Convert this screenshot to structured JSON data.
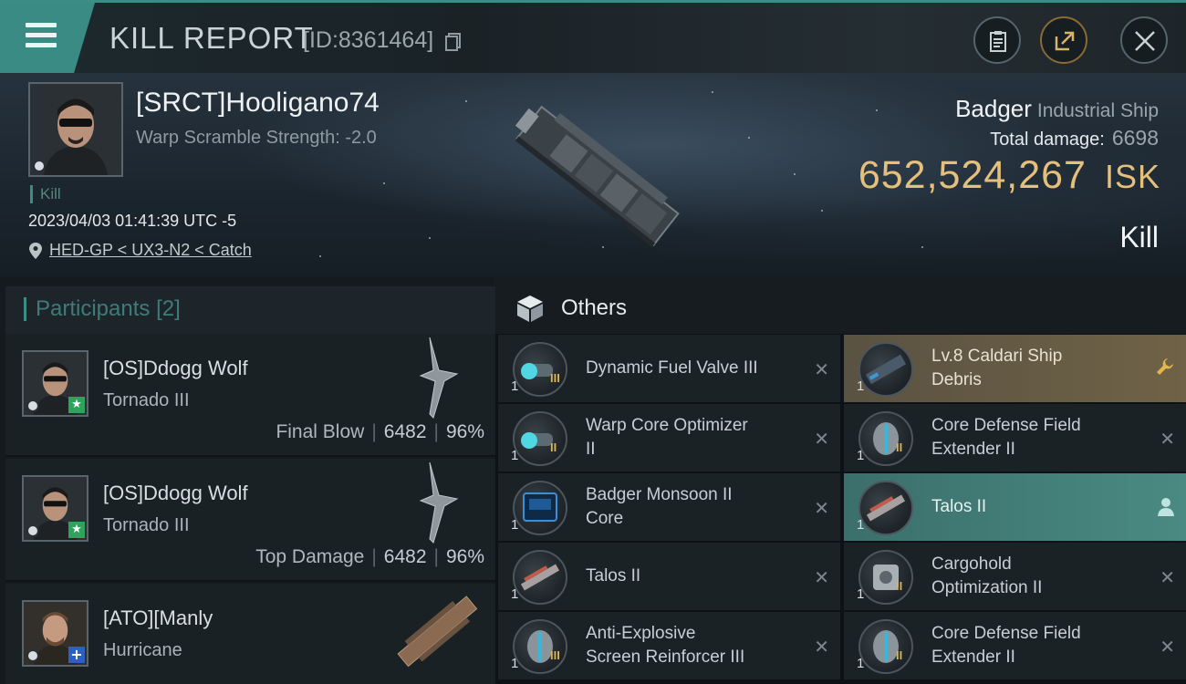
{
  "header": {
    "title": "KILL REPORT",
    "report_id": "[ID:8361464]",
    "icons": [
      "menu-icon",
      "copy-icon",
      "clipboard-icon",
      "share-icon",
      "close-icon"
    ]
  },
  "victim": {
    "name": "[SRCT]Hooligano74",
    "subtitle": "Warp Scramble Strength: -2.0",
    "tag": "Kill",
    "time": "2023/04/03 01:41:39 UTC -5",
    "location": "HED-GP < UX3-N2 < Catch",
    "ship": "Badger",
    "ship_class": "Industrial Ship",
    "total_damage_label": "Total damage:",
    "total_damage": "6698",
    "isk_value": "652,524,267",
    "isk_unit": "ISK",
    "result": "Kill"
  },
  "participants": {
    "title": "Participants",
    "count": "[2]",
    "rows": [
      {
        "name": "[OS]Ddogg Wolf",
        "ship": "Tornado III",
        "label": "Final Blow",
        "damage": "6482",
        "percent": "96%"
      },
      {
        "name": "[OS]Ddogg Wolf",
        "ship": "Tornado III",
        "label": "Top Damage",
        "damage": "6482",
        "percent": "96%"
      },
      {
        "name": "[ATO][Manly",
        "ship": "Hurricane"
      }
    ]
  },
  "others": {
    "title": "Others",
    "left": [
      {
        "qty": "1",
        "tier": "III",
        "line1": "Dynamic Fuel Valve III",
        "line2": "",
        "icon": "fuel-valve-icon"
      },
      {
        "qty": "1",
        "tier": "II",
        "line1": "Warp Core Optimizer",
        "line2": "II",
        "icon": "warp-core-icon"
      },
      {
        "qty": "1",
        "tier": "",
        "line1": "Badger Monsoon II",
        "line2": "Core",
        "icon": "core-chip-icon"
      },
      {
        "qty": "1",
        "tier": "",
        "line1": "Talos II",
        "line2": "",
        "icon": "talos-ship-icon"
      },
      {
        "qty": "1",
        "tier": "III",
        "line1": "Anti-Explosive",
        "line2": "Screen Reinforcer III",
        "icon": "shield-module-icon"
      }
    ],
    "right": [
      {
        "qty": "1",
        "tier": "",
        "line1": "Lv.8 Caldari Ship",
        "line2": "Debris",
        "icon": "debris-icon"
      },
      {
        "qty": "1",
        "tier": "II",
        "line1": "Core Defense Field",
        "line2": "Extender II",
        "icon": "shield-module-icon"
      },
      {
        "qty": "1",
        "tier": "",
        "line1": "Talos II",
        "line2": "",
        "icon": "talos-ship-icon"
      },
      {
        "qty": "1",
        "tier": "II",
        "line1": "Cargohold",
        "line2": "Optimization II",
        "icon": "cargohold-icon"
      },
      {
        "qty": "1",
        "tier": "II",
        "line1": "Core Defense Field",
        "line2": "Extender II",
        "icon": "shield-module-icon"
      }
    ]
  },
  "colors": {
    "accent": "#3c8d86",
    "isk": "#e4c07c",
    "gold_row": "#6f6246",
    "teal_row": "#4a8a83",
    "star_badge": "#2fa35c",
    "plus_badge": "#2d5fc7"
  }
}
